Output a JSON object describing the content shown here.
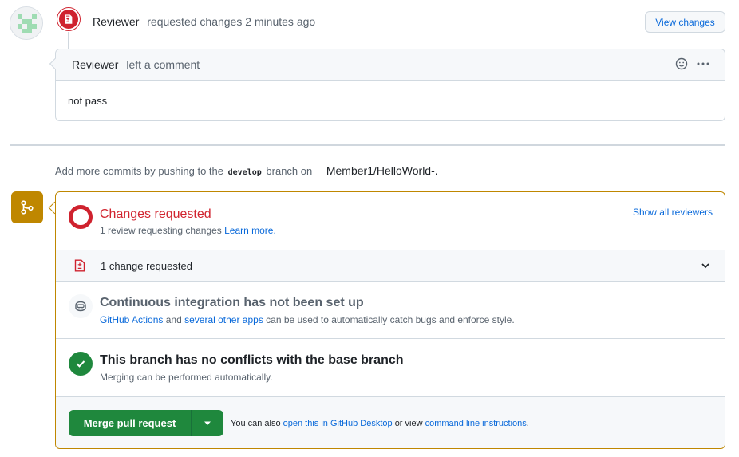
{
  "review_event": {
    "author": "Reviewer",
    "action": "requested changes",
    "time": "2 minutes ago",
    "view_changes_label": "View changes",
    "icon": "file-diff-icon"
  },
  "comment": {
    "author": "Reviewer",
    "action": "left a comment",
    "body": "not pass",
    "icons": [
      "smiley-icon",
      "kebab-horizontal-icon"
    ]
  },
  "push_hint": {
    "prefix": "Add more commits by pushing to the",
    "branch": "develop",
    "middle": "branch on",
    "repo": "Member1/HelloWorld-."
  },
  "merge_box": {
    "review": {
      "title": "Changes requested",
      "subtitle": "1 review requesting changes",
      "learn_more": "Learn more.",
      "show_all": "Show all reviewers"
    },
    "change_requested": {
      "label": "1 change requested"
    },
    "ci": {
      "title": "Continuous integration has not been set up",
      "link1": "GitHub Actions",
      "and": "and",
      "link2": "several other apps",
      "rest": "can be used to automatically catch bugs and enforce style."
    },
    "conflicts": {
      "title": "This branch has no conflicts with the base branch",
      "subtitle": "Merging can be performed automatically."
    },
    "merge": {
      "button_label": "Merge pull request",
      "hint_prefix": "You can also",
      "desktop_link": "open this in GitHub Desktop",
      "hint_mid": "or view",
      "cli_link": "command line instructions",
      "hint_end": "."
    }
  },
  "colors": {
    "danger": "#cf222e",
    "attention": "#bf8700",
    "success": "#1f883d",
    "link": "#0969da"
  }
}
